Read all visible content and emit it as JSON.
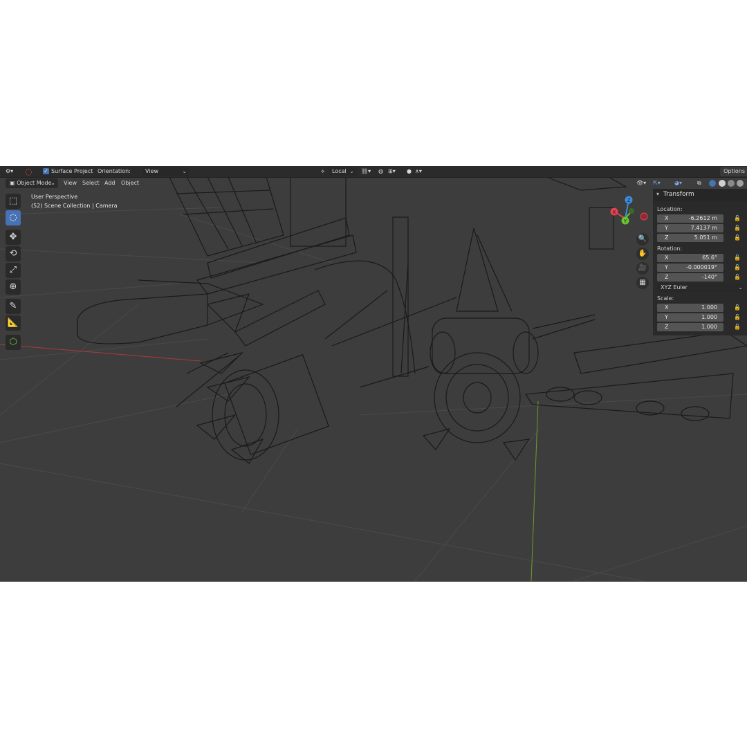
{
  "header": {
    "surface_project_label": "Surface Project",
    "orientation_label": "Orientation:",
    "orientation_value": "View",
    "pivot_value": "Local",
    "options_label": "Options"
  },
  "menu": {
    "mode": "Object Mode",
    "view": "View",
    "select": "Select",
    "add": "Add",
    "object": "Object"
  },
  "viewport": {
    "perspective": "User Perspective",
    "collection": "(52) Scene Collection | Camera"
  },
  "gizmo": {
    "x_label": "X",
    "y_label": "Y",
    "z_label": "Z",
    "x_color": "#e8414f",
    "y_color": "#6ac631",
    "z_color": "#3b8ede"
  },
  "transform": {
    "title": "Transform",
    "location_label": "Location:",
    "location": [
      {
        "axis": "X",
        "value": "-6.2612 m"
      },
      {
        "axis": "Y",
        "value": "7.4137 m"
      },
      {
        "axis": "Z",
        "value": "5.051 m"
      }
    ],
    "rotation_label": "Rotation:",
    "rotation": [
      {
        "axis": "X",
        "value": "65.6°"
      },
      {
        "axis": "Y",
        "value": "-0.000019°"
      },
      {
        "axis": "Z",
        "value": "-140°"
      }
    ],
    "rotation_mode": "XYZ Euler",
    "scale_label": "Scale:",
    "scale": [
      {
        "axis": "X",
        "value": "1.000"
      },
      {
        "axis": "Y",
        "value": "1.000"
      },
      {
        "axis": "Z",
        "value": "1.000"
      }
    ]
  },
  "colors": {
    "active_tool": "#4772b3",
    "viewport_bg": "#3d3d3d",
    "x_axis_line": "#b03a3a",
    "y_axis_line": "#6f9a30"
  }
}
